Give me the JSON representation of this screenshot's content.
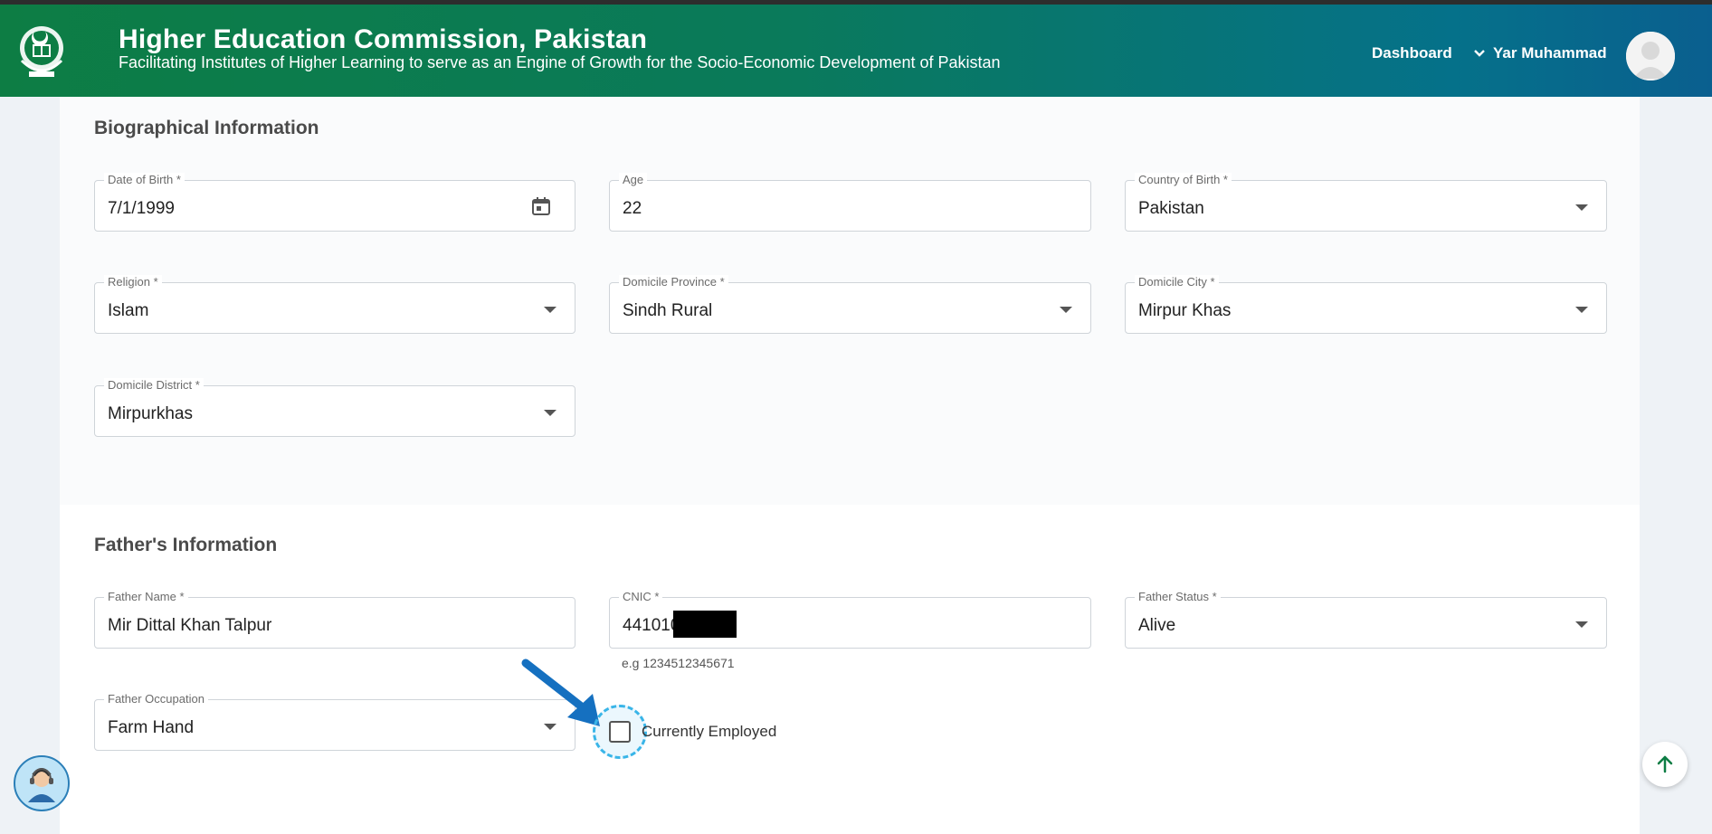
{
  "header": {
    "title": "Higher Education Commission, Pakistan",
    "subtitle": "Facilitating Institutes of Higher Learning to serve as an Engine of Growth for the Socio-Economic Development of Pakistan",
    "dashboard_label": "Dashboard",
    "user_name": "Yar Muhammad"
  },
  "biographical": {
    "title": "Biographical Information",
    "dob": {
      "label": "Date of Birth *",
      "value": "7/1/1999"
    },
    "age": {
      "label": "Age",
      "value": "22"
    },
    "country": {
      "label": "Country of Birth *",
      "value": "Pakistan"
    },
    "religion": {
      "label": "Religion *",
      "value": "Islam"
    },
    "domicile_province": {
      "label": "Domicile Province *",
      "value": "Sindh Rural"
    },
    "domicile_city": {
      "label": "Domicile City *",
      "value": "Mirpur Khas"
    },
    "domicile_district": {
      "label": "Domicile District *",
      "value": "Mirpurkhas"
    }
  },
  "father": {
    "title": "Father's Information",
    "name": {
      "label": "Father Name *",
      "value": "Mir Dittal Khan Talpur"
    },
    "cnic": {
      "label": "CNIC *",
      "value": "441010",
      "helper": "e.g 1234512345671"
    },
    "status": {
      "label": "Father Status *",
      "value": "Alive"
    },
    "occupation": {
      "label": "Father Occupation",
      "value": "Farm Hand"
    },
    "currently_employed_label": "Currently Employed",
    "currently_employed_checked": false
  },
  "colors": {
    "header_start": "#0d7d44",
    "header_end": "#0a5f8f",
    "highlight": "#39b5e8",
    "arrow": "#1570c0"
  }
}
